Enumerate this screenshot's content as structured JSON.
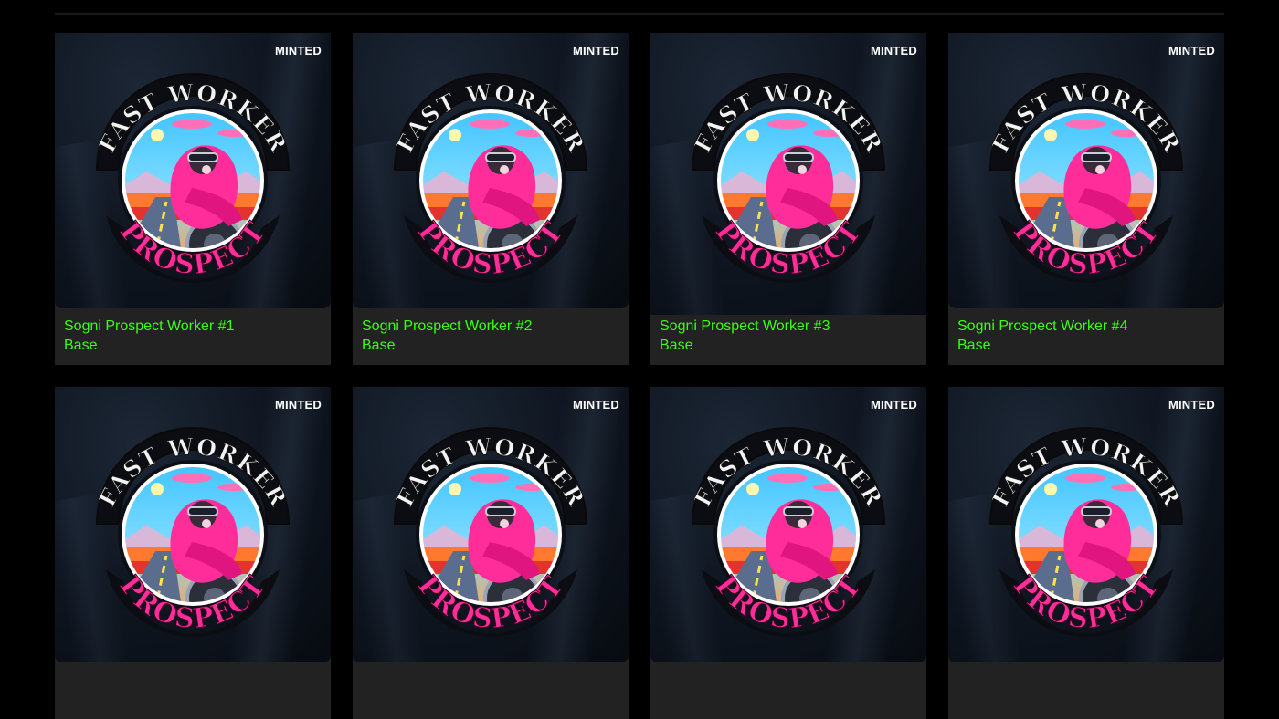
{
  "colors": {
    "background": "#000000",
    "card_bg": "#222222",
    "accent_green": "#39ff14",
    "badge_text": "#ffffff",
    "patch_pink": "#ff2d9a"
  },
  "patch_text": {
    "top": "FAST WORKER",
    "bottom": "PROSPECT"
  },
  "cards": [
    {
      "badge": "MINTED",
      "title": "Sogni Prospect Worker #1",
      "tier": "Base"
    },
    {
      "badge": "MINTED",
      "title": "Sogni Prospect Worker #2",
      "tier": "Base"
    },
    {
      "badge": "MINTED",
      "title": "Sogni Prospect Worker #3",
      "tier": "Base"
    },
    {
      "badge": "MINTED",
      "title": "Sogni Prospect Worker #4",
      "tier": "Base"
    },
    {
      "badge": "MINTED",
      "title": "",
      "tier": ""
    },
    {
      "badge": "MINTED",
      "title": "",
      "tier": ""
    },
    {
      "badge": "MINTED",
      "title": "",
      "tier": ""
    },
    {
      "badge": "MINTED",
      "title": "",
      "tier": ""
    }
  ]
}
